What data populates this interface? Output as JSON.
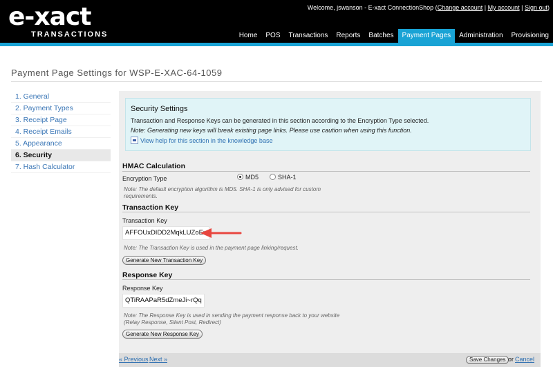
{
  "brand": {
    "logo_text": "e-xact",
    "logo_sub": "TRANSACTIONS",
    "accent": "#19a3d5"
  },
  "userbar": {
    "welcome": "Welcome, jswanson",
    "sep1": " - ",
    "app": "E-xact ConnectionShop (",
    "change_account": "Change account",
    "pipe1": " | ",
    "my_account": "My account",
    "pipe2": " | ",
    "sign_out": "Sign out",
    "close": ")"
  },
  "nav": {
    "tabs": [
      "Home",
      "POS",
      "Transactions",
      "Reports",
      "Batches",
      "Payment Pages",
      "Administration",
      "Provisioning"
    ],
    "active": "Payment Pages"
  },
  "page": {
    "title": "Payment Page Settings for WSP-E-XAC-64-1059"
  },
  "sidemenu": {
    "items": [
      "1. General",
      "2. Payment Types",
      "3. Receipt Page",
      "4. Receipt Emails",
      "5. Appearance",
      "6. Security",
      "7. Hash Calculator"
    ],
    "active": "6. Security"
  },
  "info": {
    "heading": "Security Settings",
    "text1": "Transaction and Response Keys can be generated in this section according to the Encryption Type selected.",
    "text2": "Note: Generating new keys will break existing page links. Please use caution when using this function.",
    "help": "View help for this section in the knowledge base",
    "help_icon": "pdf-icon"
  },
  "hmac": {
    "heading": "HMAC Calculation",
    "label": "Encryption Type",
    "options": [
      "MD5",
      "SHA-1"
    ],
    "selected": "MD5",
    "note_line1": "Note: The default encryption algorithm is MD5. SHA-1 is only advised for custom",
    "note_line2": "requirements."
  },
  "transaction_key": {
    "heading": "Transaction Key",
    "label": "Transaction Key",
    "value": "AFFOUxDIDD2MqkLUZoEx",
    "note": "Note: The Transaction Key is used in the payment page linking/request.",
    "button": "Generate New Transaction Key"
  },
  "response_key": {
    "heading": "Response Key",
    "label": "Response Key",
    "value": "QTiRAAPaR5dZmeJi~rQq",
    "note_line1": "Note: The Response Key is used in sending the payment response back to your website",
    "note_line2": "(Relay Response, Silent Post, Redirect)",
    "button": "Generate New Response Key"
  },
  "footer": {
    "prev": "« Previous",
    "next": "Next »",
    "save": "Save Changes",
    "or": "or",
    "cancel": "Cancel"
  },
  "annotation": {
    "arrow_color": "#e8463f"
  }
}
